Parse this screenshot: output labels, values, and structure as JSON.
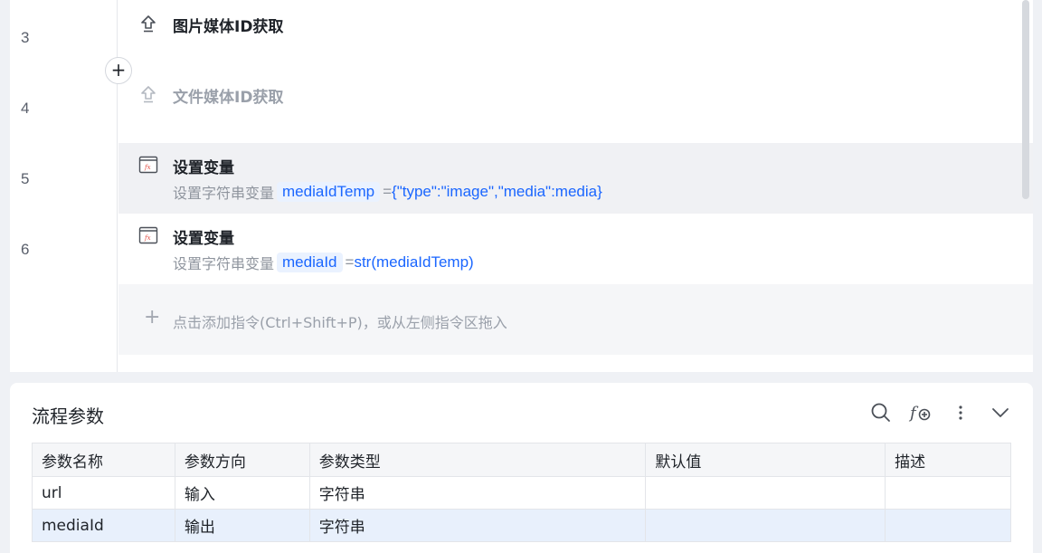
{
  "editor": {
    "line_numbers": [
      "3",
      "4",
      "5",
      "6"
    ],
    "steps": [
      {
        "title": "图片媒体ID获取",
        "icon": "upload-icon"
      },
      {
        "title": "文件媒体ID获取",
        "icon": "upload-icon",
        "disabled": true
      },
      {
        "title": "设置变量",
        "icon": "fx-icon",
        "desc_prefix": "设置字符串变量",
        "var": "mediaIdTemp",
        "eq": "=",
        "expr": "{\"type\":\"image\",\"media\":media}"
      },
      {
        "title": "设置变量",
        "icon": "fx-icon",
        "desc_prefix": "设置字符串变量",
        "var": "mediaId",
        "eq": "=",
        "expr": "str(mediaIdTemp)"
      }
    ],
    "insert_button": "+",
    "add_hint_plus": "+",
    "add_hint": "点击添加指令(Ctrl+Shift+P)，或从左侧指令区拖入"
  },
  "params": {
    "title": "流程参数",
    "toolbar_icons": [
      "search-icon",
      "add-function-icon",
      "more-vertical-icon",
      "chevron-down-icon"
    ],
    "columns": [
      "参数名称",
      "参数方向",
      "参数类型",
      "默认值",
      "描述"
    ],
    "rows": [
      [
        "url",
        "输入",
        "字符串",
        "",
        ""
      ],
      [
        "mediaId",
        "输出",
        "字符串",
        "",
        ""
      ]
    ]
  },
  "colors": {
    "accent": "#1a66ff",
    "chip_bg": "#eaf2ff",
    "selected_row": "#e8f0fc",
    "highlight_row": "#f0f1f4"
  }
}
